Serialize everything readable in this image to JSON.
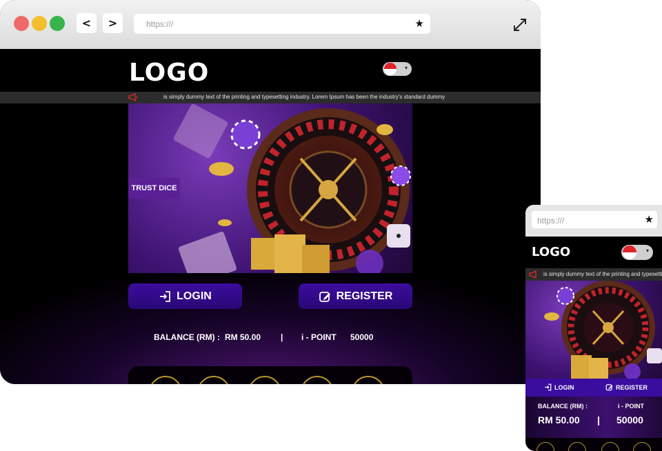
{
  "desktop": {
    "window": {
      "dots": [
        "close-dot",
        "minimize-dot",
        "maximize-dot"
      ]
    },
    "nav": {
      "back": "<",
      "forward": ">"
    },
    "url": {
      "text": "https:///"
    },
    "logo": "LOGO",
    "language": {
      "selected": "Singapore",
      "caret": "▾"
    },
    "ticker": "is simply dummy text of the printing and typesetting industry. Lorem Ipsum has been the industry's standard dummy",
    "banner": {
      "tag": "TRUST DICE"
    },
    "buttons": {
      "login": "LOGIN",
      "register": "REGISTER"
    },
    "balance": {
      "label": "BALANCE (RM) :",
      "value": "RM 50.00",
      "divider": "|",
      "points_label": "i - POINT",
      "points_value": "50000"
    }
  },
  "mobile": {
    "url": {
      "text": "https:///"
    },
    "logo": "LOGO",
    "language": {
      "selected": "Singapore",
      "caret": "▾"
    },
    "ticker": "is simply dummy text of the printing and typesetting industry.",
    "buttons": {
      "login": "LOGIN",
      "register": "REGISTER"
    },
    "balance": {
      "label": "BALANCE (RM) :",
      "value": "RM 50.00",
      "divider": "|",
      "points_label": "i - POINT",
      "points_value": "50000"
    }
  },
  "colors": {
    "accent": "#3b0d9c",
    "gold": "#b8962c",
    "ticker_bg": "#2c2c2c",
    "brand_purple": "#5b1f96"
  },
  "icons": [
    "back-icon",
    "forward-icon",
    "bookmark-star-icon",
    "expand-icon",
    "flag-icon",
    "megaphone-icon",
    "login-icon",
    "register-icon"
  ]
}
